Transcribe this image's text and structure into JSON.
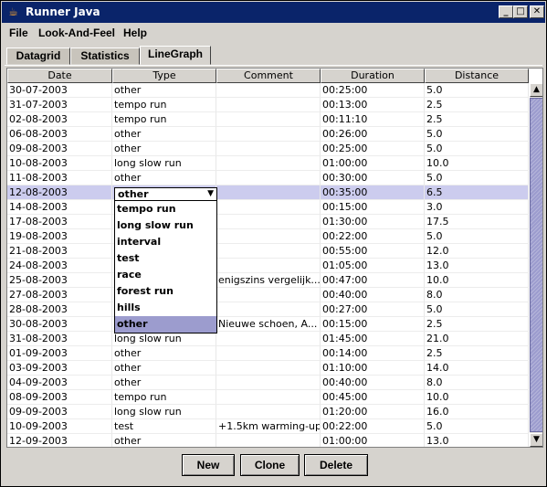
{
  "window": {
    "title": "Runner Java",
    "icon": "java-cup-icon"
  },
  "menu": [
    "File",
    "Look-And-Feel",
    "Help"
  ],
  "tabs": [
    "Datagrid",
    "Statistics",
    "LineGraph"
  ],
  "table": {
    "columns": [
      "Date",
      "Type",
      "Comment",
      "Duration",
      "Distance"
    ],
    "rows": [
      [
        "30-07-2003",
        "other",
        "",
        "00:25:00",
        "5.0"
      ],
      [
        "31-07-2003",
        "tempo run",
        "",
        "00:13:00",
        "2.5"
      ],
      [
        "02-08-2003",
        "tempo run",
        "",
        "00:11:10",
        "2.5"
      ],
      [
        "06-08-2003",
        "other",
        "",
        "00:26:00",
        "5.0"
      ],
      [
        "09-08-2003",
        "other",
        "",
        "00:25:00",
        "5.0"
      ],
      [
        "10-08-2003",
        "long slow run",
        "",
        "01:00:00",
        "10.0"
      ],
      [
        "11-08-2003",
        "other",
        "",
        "00:30:00",
        "5.0"
      ],
      [
        "12-08-2003",
        "",
        "",
        "00:35:00",
        "6.5"
      ],
      [
        "14-08-2003",
        "",
        "",
        "00:15:00",
        "3.0"
      ],
      [
        "17-08-2003",
        "",
        "",
        "01:30:00",
        "17.5"
      ],
      [
        "19-08-2003",
        "",
        "",
        "00:22:00",
        "5.0"
      ],
      [
        "21-08-2003",
        "",
        "",
        "00:55:00",
        "12.0"
      ],
      [
        "24-08-2003",
        "",
        "",
        "01:05:00",
        "13.0"
      ],
      [
        "25-08-2003",
        "",
        "enigszins vergelijk...",
        "00:47:00",
        "10.0"
      ],
      [
        "27-08-2003",
        "",
        "",
        "00:40:00",
        "8.0"
      ],
      [
        "28-08-2003",
        "",
        "",
        "00:27:00",
        "5.0"
      ],
      [
        "30-08-2003",
        "",
        "Nieuwe schoen, A...",
        "00:15:00",
        "2.5"
      ],
      [
        "31-08-2003",
        "long slow run",
        "",
        "01:45:00",
        "21.0"
      ],
      [
        "01-09-2003",
        "other",
        "",
        "00:14:00",
        "2.5"
      ],
      [
        "03-09-2003",
        "other",
        "",
        "01:10:00",
        "14.0"
      ],
      [
        "04-09-2003",
        "other",
        "",
        "00:40:00",
        "8.0"
      ],
      [
        "08-09-2003",
        "tempo run",
        "",
        "00:45:00",
        "10.0"
      ],
      [
        "09-09-2003",
        "long slow run",
        "",
        "01:20:00",
        "16.0"
      ],
      [
        "10-09-2003",
        "test",
        "+1.5km warming-up",
        "00:22:00",
        "5.0"
      ],
      [
        "12-09-2003",
        "other",
        "",
        "01:00:00",
        "13.0"
      ]
    ]
  },
  "combo": {
    "value": "other"
  },
  "dropdown": [
    "tempo run",
    "long slow run",
    "interval",
    "test",
    "race",
    "forest run",
    "hills",
    "other"
  ],
  "buttons": {
    "new": "New",
    "clone": "Clone",
    "delete": "Delete"
  }
}
